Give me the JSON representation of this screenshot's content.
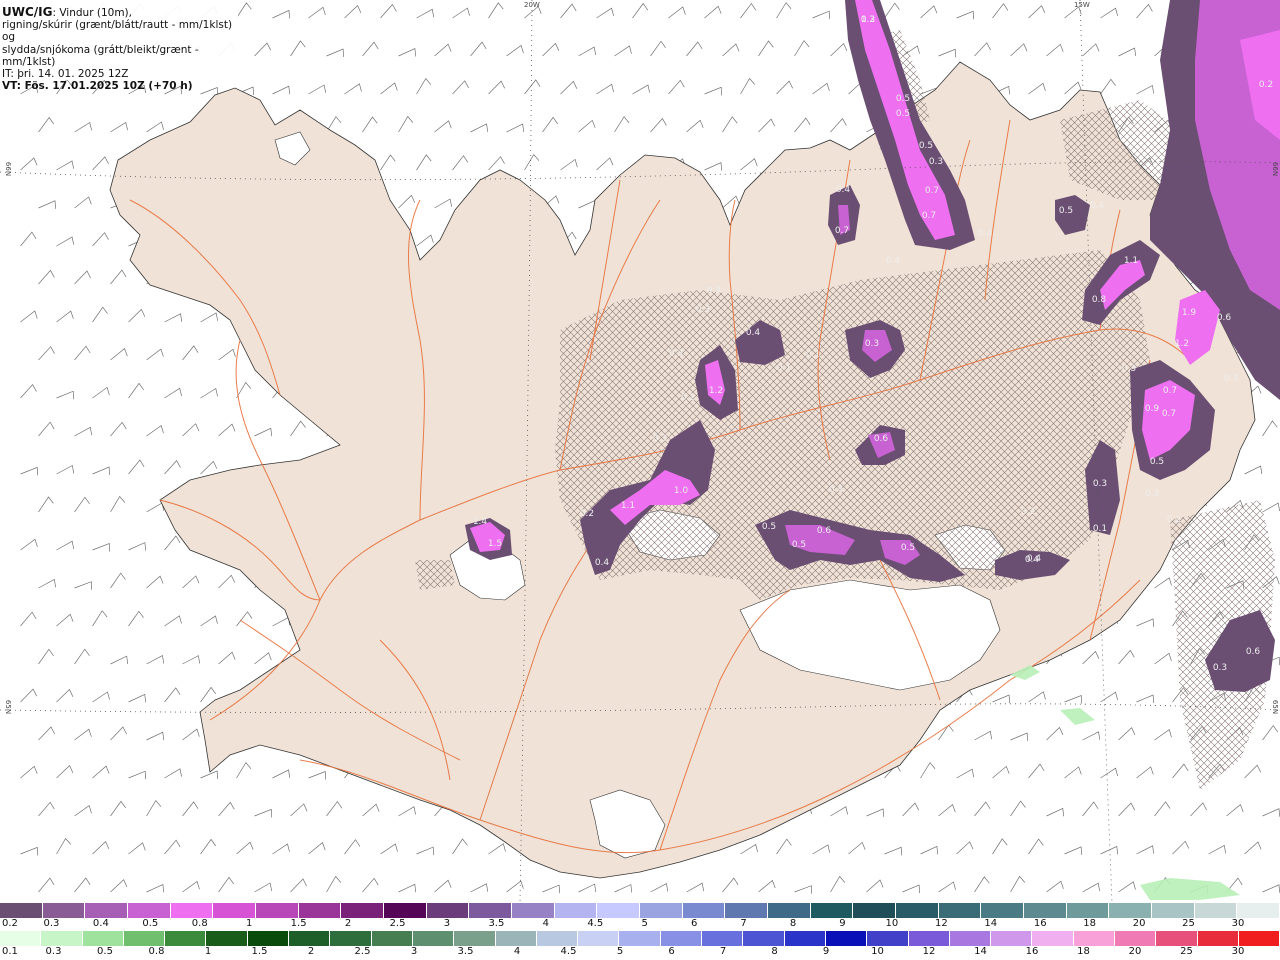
{
  "info": {
    "line1_bold": "UWC/IG",
    "line1_rest": ": Vindur (10m),",
    "line2": "rigning/skúrir (grænt/blátt/rautt - mm/1klst) og",
    "line3": "slydda/snjókoma (grátt/bleikt/grænt - mm/1klst)",
    "line4": "IT: þri. 14. 01. 2025 12Z",
    "line5": "VT: Fös. 17.01.2025 10Z (+70 h)"
  },
  "grid_labels": {
    "top_left": "20W",
    "top_right": "15W",
    "left_upper": "66N",
    "left_lower": "65N",
    "right_upper": "66N",
    "right_lower": "65N"
  },
  "map_values": [
    "1.2",
    "0.5",
    "0.5",
    "0.5",
    "0.3",
    "0.7",
    "0.7",
    "0.4",
    "0.4",
    "0.7",
    "0.4",
    "0.5",
    "0.4",
    "1.1",
    "0.8",
    "1.9",
    "0.6",
    "1.2",
    "0.3",
    "0.3",
    "0.4",
    "0.3",
    "0.3",
    "0.2",
    "0.1",
    "0.1",
    "1.2",
    "0.3",
    "0.3",
    "0.4",
    "0.2",
    "0.1",
    "0.7",
    "0.9",
    "0.7",
    "0.5",
    "0.6",
    "0.3",
    "0.3",
    "0.2",
    "1.0",
    "1.1",
    "0.2",
    "0.4",
    "0.3",
    "1.4",
    "1.5",
    "0.5",
    "0.5",
    "0.6",
    "0.5",
    "0.4",
    "0.4",
    "0.3",
    "0.2",
    "0.6",
    "0.3"
  ],
  "legend": {
    "snow_colors": [
      "#6a4f72",
      "#8a5c96",
      "#a65fb4",
      "#c861d2",
      "#ee6ff0",
      "#d653d6",
      "#b848b8",
      "#9a3699",
      "#7a227a",
      "#560656",
      "#6b3d7a",
      "#7d5a9e",
      "#9682c4",
      "#b4b4f0",
      "#c6c9ff",
      "#9aa4e0",
      "#7a8ad0",
      "#5f78b0",
      "#3f6a88",
      "#1e5a60",
      "#204e58",
      "#2a5c68",
      "#3a6c78",
      "#4a7a84",
      "#5c8a90",
      "#6f9a9c",
      "#8ab0b0",
      "#a8c4c4",
      "#c8d8d6",
      "#e6efee"
    ],
    "snow_ticks": [
      "0.2",
      "0.3",
      "0.4",
      "0.5",
      "0.8",
      "1",
      "1.5",
      "2",
      "2.5",
      "3",
      "3.5",
      "4",
      "4.5",
      "5",
      "6",
      "7",
      "8",
      "9",
      "10",
      "12",
      "14",
      "16",
      "18",
      "20",
      "25",
      "30"
    ],
    "rain_colors": [
      "#e6fde6",
      "#c8f5c8",
      "#9ee29e",
      "#6fbf6f",
      "#3c8a3c",
      "#1a5c1a",
      "#0a4a0a",
      "#1e5e28",
      "#2e6e3c",
      "#467e52",
      "#5e9070",
      "#7aa08c",
      "#9ab4b8",
      "#b8c8e0",
      "#c8d0f4",
      "#a8b0ee",
      "#8890e6",
      "#6870de",
      "#4c54d4",
      "#2a34c8",
      "#0a10b8",
      "#4040c8",
      "#7a5ad8",
      "#a878e0",
      "#d098ea",
      "#f0b0f0",
      "#f8a0d8",
      "#f07ab4",
      "#e8507c",
      "#e82c3c",
      "#f01e1e"
    ],
    "rain_ticks": [
      "0.1",
      "0.3",
      "0.5",
      "0.8",
      "1",
      "1.5",
      "2",
      "2.5",
      "3",
      "3.5",
      "4",
      "4.5",
      "5",
      "6",
      "7",
      "8",
      "9",
      "10",
      "12",
      "14",
      "16",
      "18",
      "20",
      "25",
      "30"
    ]
  }
}
